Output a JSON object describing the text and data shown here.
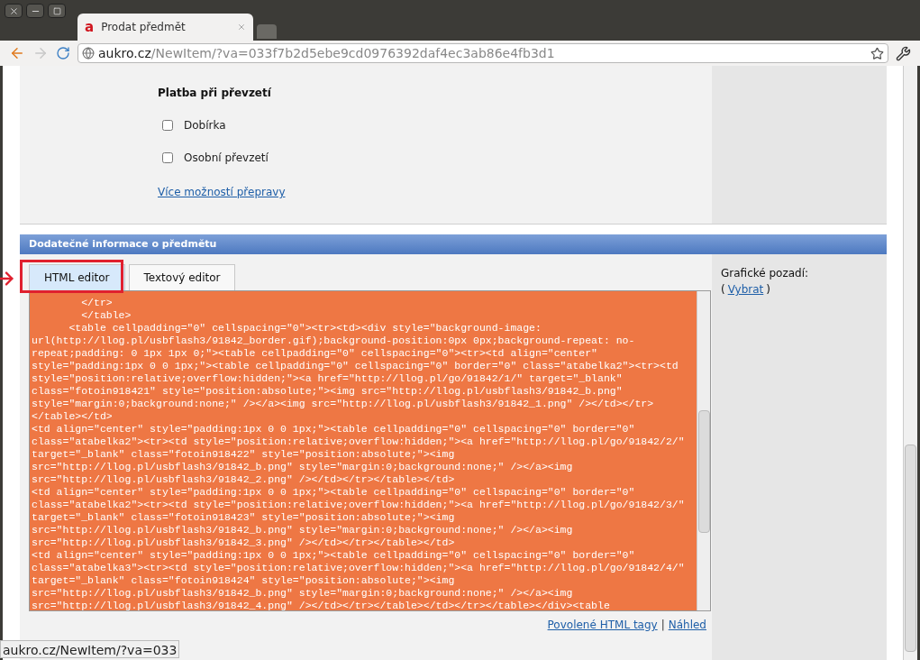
{
  "browser_tab": {
    "favicon": "a",
    "title": "Prodat předmět"
  },
  "address_bar": {
    "host": "aukro.cz",
    "path": "/NewItem/?va=033f7b2d5ebe9cd0976392daf4ec3ab86e4fb3d1"
  },
  "payment": {
    "heading": "Platba při převzetí",
    "options": [
      {
        "label": "Dobírka",
        "checked": false
      },
      {
        "label": "Osobní převzetí",
        "checked": false
      }
    ],
    "more_link": "Více možností přepravy"
  },
  "section_header": "Dodatečné informace o předmětu",
  "editor_tabs": [
    {
      "label": "HTML editor",
      "selected": true,
      "highlighted": true
    },
    {
      "label": "Textový editor",
      "selected": false,
      "highlighted": false
    }
  ],
  "code_lines": [
    "        </tr>",
    "        </table>",
    "      <table cellpadding=\"0\" cellspacing=\"0\"><tr><td><div style=\"background-image:",
    "url(http://llog.pl/usbflash3/91842_border.gif);background-position:0px 0px;background-repeat: no-",
    "repeat;padding: 0 1px 1px 0;\"><table cellpadding=\"0\" cellspacing=\"0\"><tr><td align=\"center\"",
    "style=\"padding:1px 0 0 1px;\"><table cellpadding=\"0\" cellspacing=\"0\" border=\"0\" class=\"atabelka2\"><tr><td",
    "style=\"position:relative;overflow:hidden;\"><a href=\"http://llog.pl/go/91842/1/\" target=\"_blank\"",
    "class=\"fotoin918421\" style=\"position:absolute;\"><img src=\"http://llog.pl/usbflash3/91842_b.png\"",
    "style=\"margin:0;background:none;\" /></a><img src=\"http://llog.pl/usbflash3/91842_1.png\" /></td></tr>",
    "</table></td>",
    "<td align=\"center\" style=\"padding:1px 0 0 1px;\"><table cellpadding=\"0\" cellspacing=\"0\" border=\"0\"",
    "class=\"atabelka2\"><tr><td style=\"position:relative;overflow:hidden;\"><a href=\"http://llog.pl/go/91842/2/\"",
    "target=\"_blank\" class=\"fotoin918422\" style=\"position:absolute;\"><img",
    "src=\"http://llog.pl/usbflash3/91842_b.png\" style=\"margin:0;background:none;\" /></a><img",
    "src=\"http://llog.pl/usbflash3/91842_2.png\" /></td></tr></table></td>",
    "<td align=\"center\" style=\"padding:1px 0 0 1px;\"><table cellpadding=\"0\" cellspacing=\"0\" border=\"0\"",
    "class=\"atabelka2\"><tr><td style=\"position:relative;overflow:hidden;\"><a href=\"http://llog.pl/go/91842/3/\"",
    "target=\"_blank\" class=\"fotoin918423\" style=\"position:absolute;\"><img",
    "src=\"http://llog.pl/usbflash3/91842_b.png\" style=\"margin:0;background:none;\" /></a><img",
    "src=\"http://llog.pl/usbflash3/91842_3.png\" /></td></tr></table></td>",
    "<td align=\"center\" style=\"padding:1px 0 0 1px;\"><table cellpadding=\"0\" cellspacing=\"0\" border=\"0\"",
    "class=\"atabelka3\"><tr><td style=\"position:relative;overflow:hidden;\"><a href=\"http://llog.pl/go/91842/4/\"",
    "target=\"_blank\" class=\"fotoin918424\" style=\"position:absolute;\"><img",
    "src=\"http://llog.pl/usbflash3/91842_b.png\" style=\"margin:0;background:none;\" /></a><img",
    "src=\"http://llog.pl/usbflash3/91842_4.png\" /></td></tr></table></td></tr></table></div><table"
  ],
  "side_panel": {
    "label": "Grafické pozadí:",
    "open_paren": "(",
    "link": "Vybrat",
    "close_paren": ")"
  },
  "footer_links": [
    {
      "kind": "link",
      "text": "Povolené HTML tagy"
    },
    {
      "kind": "separator",
      "text": "|"
    },
    {
      "kind": "link",
      "text": "Náhled"
    }
  ],
  "status_url": "aukro.cz/NewItem/?va=033"
}
